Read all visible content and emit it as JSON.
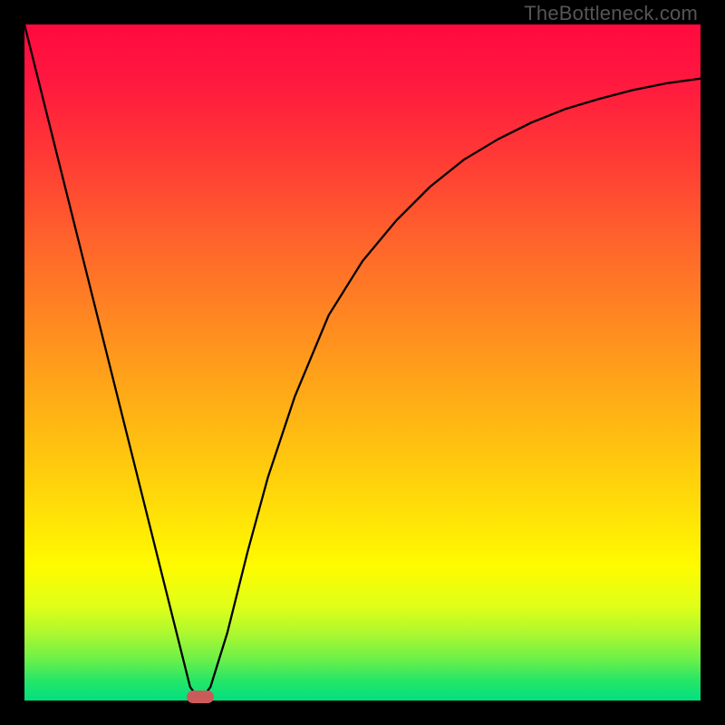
{
  "attribution": "TheBottleneck.com",
  "colors": {
    "frame": "#000000",
    "gradient_top": "#ff0a3f",
    "gradient_bottom": "#00e080",
    "curve": "#000000",
    "marker": "#cb5b5b",
    "attribution_text": "#555555"
  },
  "chart_data": {
    "type": "line",
    "title": "",
    "xlabel": "",
    "ylabel": "",
    "xlim": [
      0,
      100
    ],
    "ylim": [
      0,
      100
    ],
    "grid": false,
    "legend": false,
    "note": "Single V-shaped curve describing a bottleneck metric. Y values are relative percentage (0 at bottom, 100 at top). No axis ticks or labels are rendered in the image.",
    "series": [
      {
        "name": "curve",
        "x": [
          0,
          5,
          10,
          15,
          20,
          23,
          24.5,
          26,
          27.5,
          30,
          33,
          36,
          40,
          45,
          50,
          55,
          60,
          65,
          70,
          75,
          80,
          85,
          90,
          95,
          100
        ],
        "y": [
          100,
          80,
          60,
          40,
          20,
          8,
          2,
          0,
          2,
          10,
          22,
          33,
          45,
          57,
          65,
          71,
          76,
          80,
          83,
          85.5,
          87.5,
          89,
          90.3,
          91.3,
          92
        ]
      }
    ],
    "marker": {
      "x": 26,
      "y": 0,
      "shape": "pill"
    }
  }
}
